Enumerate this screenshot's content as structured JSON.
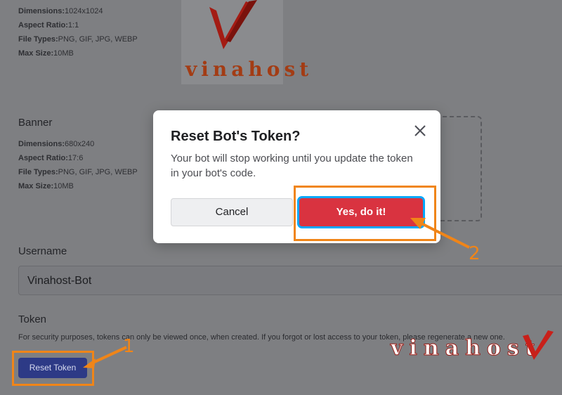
{
  "avatar_specs": {
    "dimensions_label": "Dimensions:",
    "dimensions_value": "1024x1024",
    "aspect_label": "Aspect Ratio:",
    "aspect_value": "1:1",
    "types_label": "File Types:",
    "types_value": "PNG, GIF, JPG, WEBP",
    "size_label": "Max Size:",
    "size_value": "10MB"
  },
  "banner": {
    "title": "Banner",
    "dimensions_label": "Dimensions:",
    "dimensions_value": "680x240",
    "aspect_label": "Aspect Ratio:",
    "aspect_value": "17:6",
    "types_label": "File Types:",
    "types_value": "PNG, GIF, JPG, WEBP",
    "size_label": "Max Size:",
    "size_value": "10MB"
  },
  "username": {
    "label": "Username",
    "value": "Vinahost-Bot"
  },
  "token": {
    "label": "Token",
    "description": "For security purposes, tokens can only be viewed once, when created. If you forgot or lost access to your token, please regenerate a new one.",
    "reset_label": "Reset Token"
  },
  "modal": {
    "title": "Reset Bot's Token?",
    "body": "Your bot will stop working until you update the token in your bot's code.",
    "cancel_label": "Cancel",
    "confirm_label": "Yes, do it!"
  },
  "annotations": {
    "step1": "1",
    "step2": "2"
  },
  "watermark": {
    "logo_text": "vinahost",
    "corner_text": "vinahost"
  },
  "colors": {
    "overlay": "#7e7f82",
    "confirm": "#d93340",
    "focus_ring": "#00a8fc",
    "annotation": "#f08518",
    "reset_button": "#2d3a86"
  }
}
